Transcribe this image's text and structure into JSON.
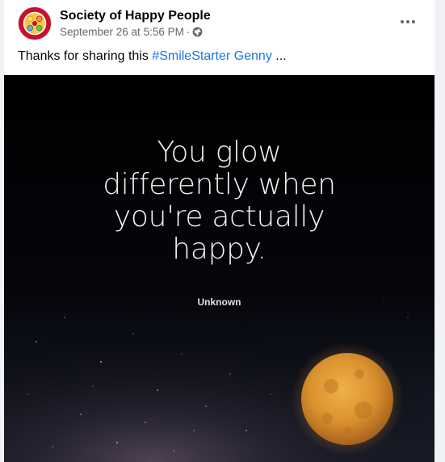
{
  "post": {
    "page_name": "Society of Happy People",
    "timestamp": "September 26 at 5:56 PM",
    "separator": "·",
    "privacy_icon": "globe-icon",
    "more_icon": "more-options-icon",
    "text_prefix": "Thanks for sharing this ",
    "hashtag": "#SmileStarter",
    "mention": "Genny",
    "text_suffix": " ..."
  },
  "image": {
    "quote_lines": [
      "You glow",
      "differently when",
      "you're actually",
      "happy."
    ],
    "author": "Unknown"
  },
  "colors": {
    "link": "#1b74e4",
    "name": "#050505",
    "meta": "#65676b",
    "moon": "#d9912e"
  }
}
